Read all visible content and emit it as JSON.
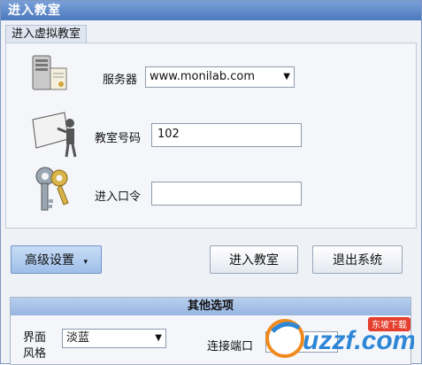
{
  "window": {
    "title": "进入教室"
  },
  "group": {
    "tab_label": "进入虚拟教室"
  },
  "server": {
    "label": "服务器",
    "value": "www.monilab.com"
  },
  "classroom": {
    "label": "教室号码",
    "value": "102"
  },
  "password": {
    "label": "进入口令",
    "value": ""
  },
  "buttons": {
    "advanced": "高级设置",
    "enter": "进入教室",
    "exit": "退出系统"
  },
  "other_options": {
    "title": "其他选项",
    "style_label_line1": "界面",
    "style_label_line2": "风格",
    "style_value": "淡蓝",
    "port_label": "连接端口"
  },
  "watermark": {
    "text": "uzzf.com",
    "badge": "东坡下载"
  },
  "icons": {
    "server": "server-icon",
    "classroom": "teacher-board-icon",
    "password": "keys-icon",
    "dropdown": "chevron-down-icon"
  }
}
